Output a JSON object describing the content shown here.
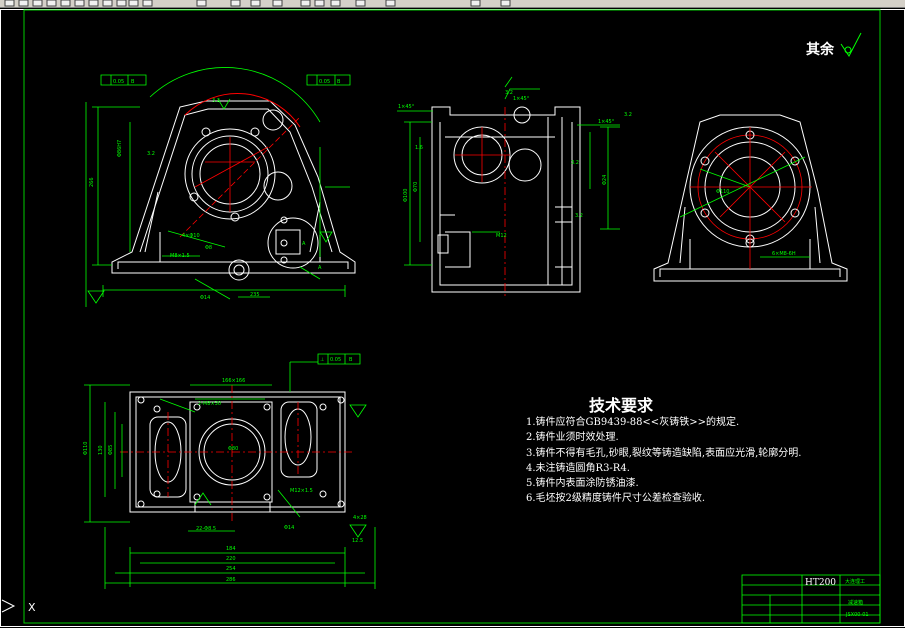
{
  "toolbar": {
    "buttons": [
      "new-icon",
      "open-icon",
      "save-icon",
      "print-icon",
      "preview-icon",
      "cut-icon",
      "copy-icon",
      "paste-icon",
      "match-icon",
      "undo-icon",
      "redo-icon",
      "pan-icon",
      "zoom-icon",
      "zoom-window-icon",
      "zoom-previous-icon",
      "properties-icon",
      "design-center-icon",
      "tool-palettes-icon",
      "sheet-set-icon",
      "markup-icon",
      "calc-icon",
      "help-icon"
    ]
  },
  "drawing": {
    "rest_roughness_label": "其余",
    "technical_requirements": {
      "title": "技术要求",
      "items": [
        "1.铸件应符合GB9439-88<<灰铸铁>>的规定.",
        "2.铸件业须时效处理.",
        "3.铸件不得有毛孔,砂眼,裂纹等铸造缺陷,表面应光滑,轮廓分明.",
        "4.未注铸造圆角R3-R4.",
        "5.铸件内表面涂防锈油漆.",
        "6.毛坯按2级精度铸件尺寸公差检查验收."
      ]
    },
    "title_block": {
      "material": "HT200"
    },
    "ucs_x": "X"
  },
  "colors": {
    "outline": "#ffffff",
    "dimension": "#00ff00",
    "centerline": "#ff0000",
    "frame": "#00cc00",
    "background": "#000000"
  }
}
